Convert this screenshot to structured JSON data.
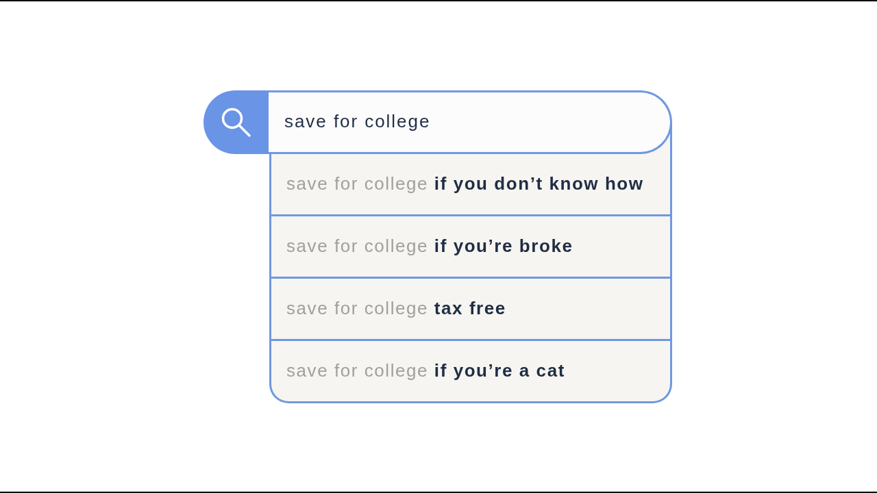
{
  "search": {
    "value": "save for college"
  },
  "suggestions": [
    {
      "text": "save for college **if you don’t know how**"
    },
    {
      "text": "save for college **if you’re broke**"
    },
    {
      "text": "save for college **tax free**"
    },
    {
      "text": "save for college **if you’re a cat**"
    }
  ]
}
